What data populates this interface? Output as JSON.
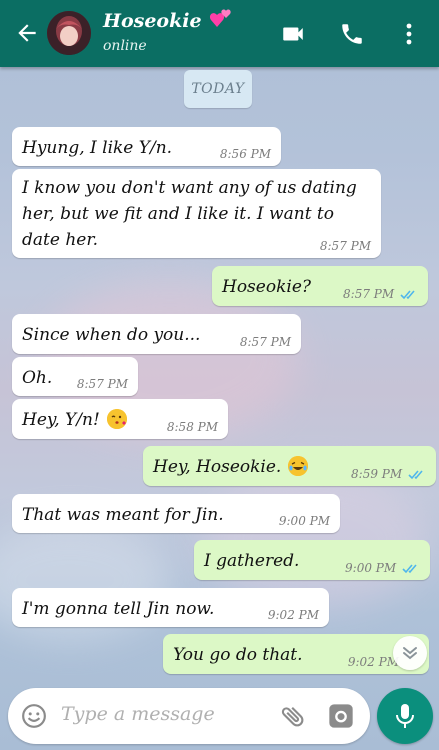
{
  "header": {
    "contact_name": "Hoseokie",
    "status": "online",
    "icons": [
      "back-arrow-icon",
      "video-call-icon",
      "phone-icon",
      "more-vert-icon"
    ]
  },
  "date_chip": "TODAY",
  "messages": [
    {
      "dir": "in",
      "text": "Hyung, I like Y/n.",
      "time": "8:56 PM"
    },
    {
      "dir": "in",
      "text": "I know you don't want any of us dating her, but we fit and I like it. I want to date her.",
      "time": "8:57 PM"
    },
    {
      "dir": "out",
      "text": "Hoseokie?",
      "time": "8:57 PM",
      "read": true
    },
    {
      "dir": "in",
      "text": "Since when do you...",
      "time": "8:57 PM"
    },
    {
      "dir": "in",
      "text": "Oh.",
      "time": "8:57 PM"
    },
    {
      "dir": "in",
      "text": "Hey, Y/n!",
      "time": "8:58 PM",
      "emoji": "kiss-emoji"
    },
    {
      "dir": "out",
      "text": "Hey, Hoseokie.",
      "time": "8:59 PM",
      "read": true,
      "emoji": "laughing-emoji"
    },
    {
      "dir": "in",
      "text": "That was meant for Jin.",
      "time": "9:00 PM"
    },
    {
      "dir": "out",
      "text": "I gathered.",
      "time": "9:00 PM",
      "read": true
    },
    {
      "dir": "in",
      "text": "I'm gonna tell Jin now.",
      "time": "9:02 PM"
    },
    {
      "dir": "out",
      "text": "You go do that.",
      "time": "9:02 PM",
      "read": true
    }
  ],
  "input": {
    "placeholder": "Type a message"
  },
  "colors": {
    "header": "#0b6e63",
    "outgoing": "#dcf8c6",
    "incoming": "#ffffff",
    "tick_read": "#4fb6ec",
    "mic": "#0b8f7d"
  }
}
